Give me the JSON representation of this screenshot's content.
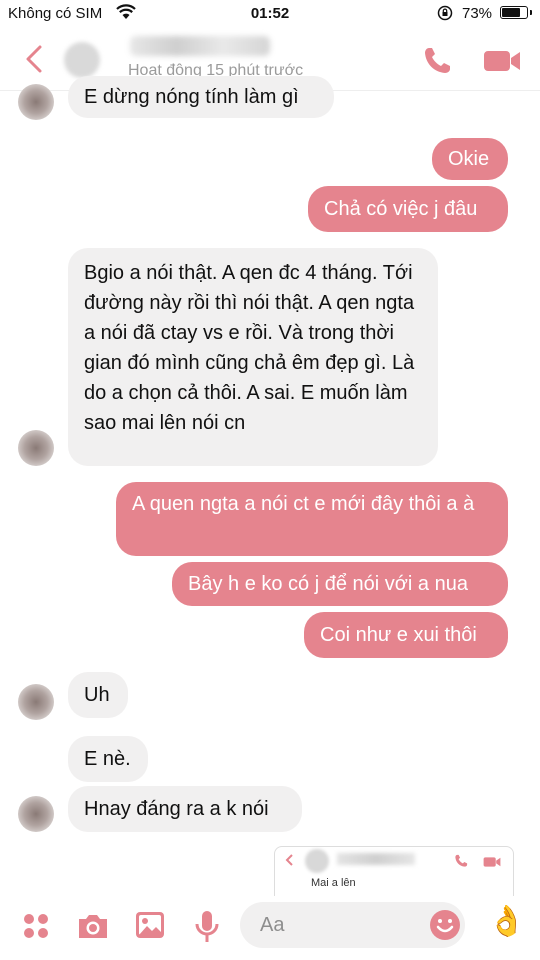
{
  "status_bar": {
    "carrier": "Không có SIM",
    "time": "01:52",
    "battery_percent": "73%",
    "battery_level": 0.73
  },
  "header": {
    "status": "Hoạt động 15 phút trước",
    "accent_color": "#e5848e"
  },
  "messages": [
    {
      "side": "in",
      "text": "E dừng nóng tính làm gì"
    },
    {
      "side": "out",
      "text": "Okie"
    },
    {
      "side": "out",
      "text": "Chả có việc j đâu"
    },
    {
      "side": "in",
      "text": "Bgio a nói thật. A qen đc 4 tháng. Tới đường này rồi thì nói thật. A qen ngta a nói đã ctay vs e rồi.  Và trong thời gian đó mình cũng chả êm đẹp gì.  Là do a chọn cả thôi. A sai. E muốn làm sao mai lên nói cn"
    },
    {
      "side": "out",
      "text": "A quen ngta a nói ct e mới đây thôi a à"
    },
    {
      "side": "out",
      "text": "Bây h e ko có j để nói với a nua"
    },
    {
      "side": "out",
      "text": "Coi như e xui thôi"
    },
    {
      "side": "in",
      "text": "Uh"
    },
    {
      "side": "in",
      "text": "E nè."
    },
    {
      "side": "in",
      "text": "Hnay đáng ra a k nói"
    }
  ],
  "embedded_screenshot": {
    "text": "Mai a lên"
  },
  "composer": {
    "placeholder": "Aa",
    "icons": [
      "menu-dots-icon",
      "camera-icon",
      "photo-icon",
      "microphone-icon",
      "emoji-icon",
      "ok-hand-icon"
    ],
    "thumb_emoji": "👌"
  }
}
